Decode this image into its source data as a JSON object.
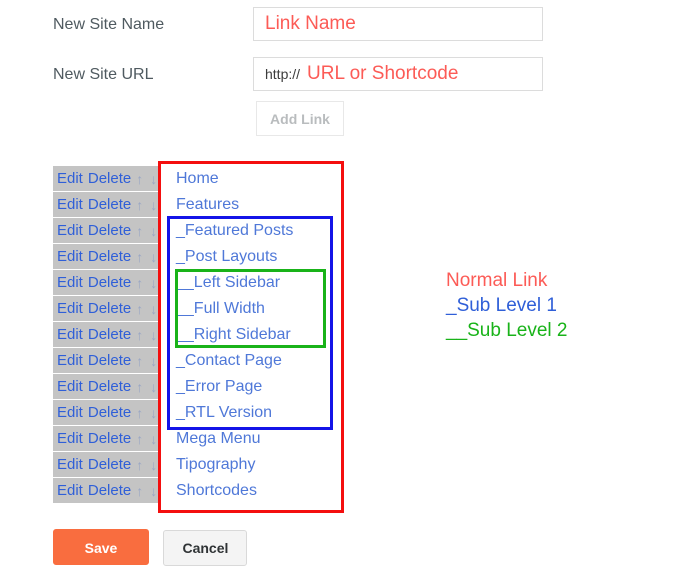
{
  "form": {
    "rows": [
      {
        "label": "New Site Name",
        "input_name": "site-name-input",
        "prefix": "",
        "value": "Link Name"
      },
      {
        "label": "New Site URL",
        "input_name": "site-url-input",
        "prefix": "http://",
        "value": "URL or Shortcode"
      }
    ],
    "add_link_label": "Add Link"
  },
  "list": {
    "controls": {
      "edit_label": "Edit",
      "delete_label": "Delete",
      "move_up_icon": "↑",
      "move_down_icon": "↓"
    },
    "items": [
      {
        "title": "Home"
      },
      {
        "title": "Features"
      },
      {
        "title": "_Featured Posts"
      },
      {
        "title": "_Post Layouts"
      },
      {
        "title": "__Left Sidebar"
      },
      {
        "title": "__Full Width"
      },
      {
        "title": "__Right Sidebar"
      },
      {
        "title": "_Contact Page"
      },
      {
        "title": "_Error Page"
      },
      {
        "title": "_RTL Version"
      },
      {
        "title": "Mega Menu"
      },
      {
        "title": "Tipography"
      },
      {
        "title": "Shortcodes"
      }
    ]
  },
  "legend": {
    "normal": "Normal Link",
    "sub1": "_Sub Level 1",
    "sub2": "__Sub Level 2"
  },
  "footer": {
    "save_label": "Save",
    "cancel_label": "Cancel"
  },
  "colors": {
    "normal_link": "#fc5b56",
    "sub_level_1": "#2f5fd8",
    "sub_level_2": "#19b319",
    "save_button": "#f96d3f",
    "row_background": "#c4c4c4"
  }
}
